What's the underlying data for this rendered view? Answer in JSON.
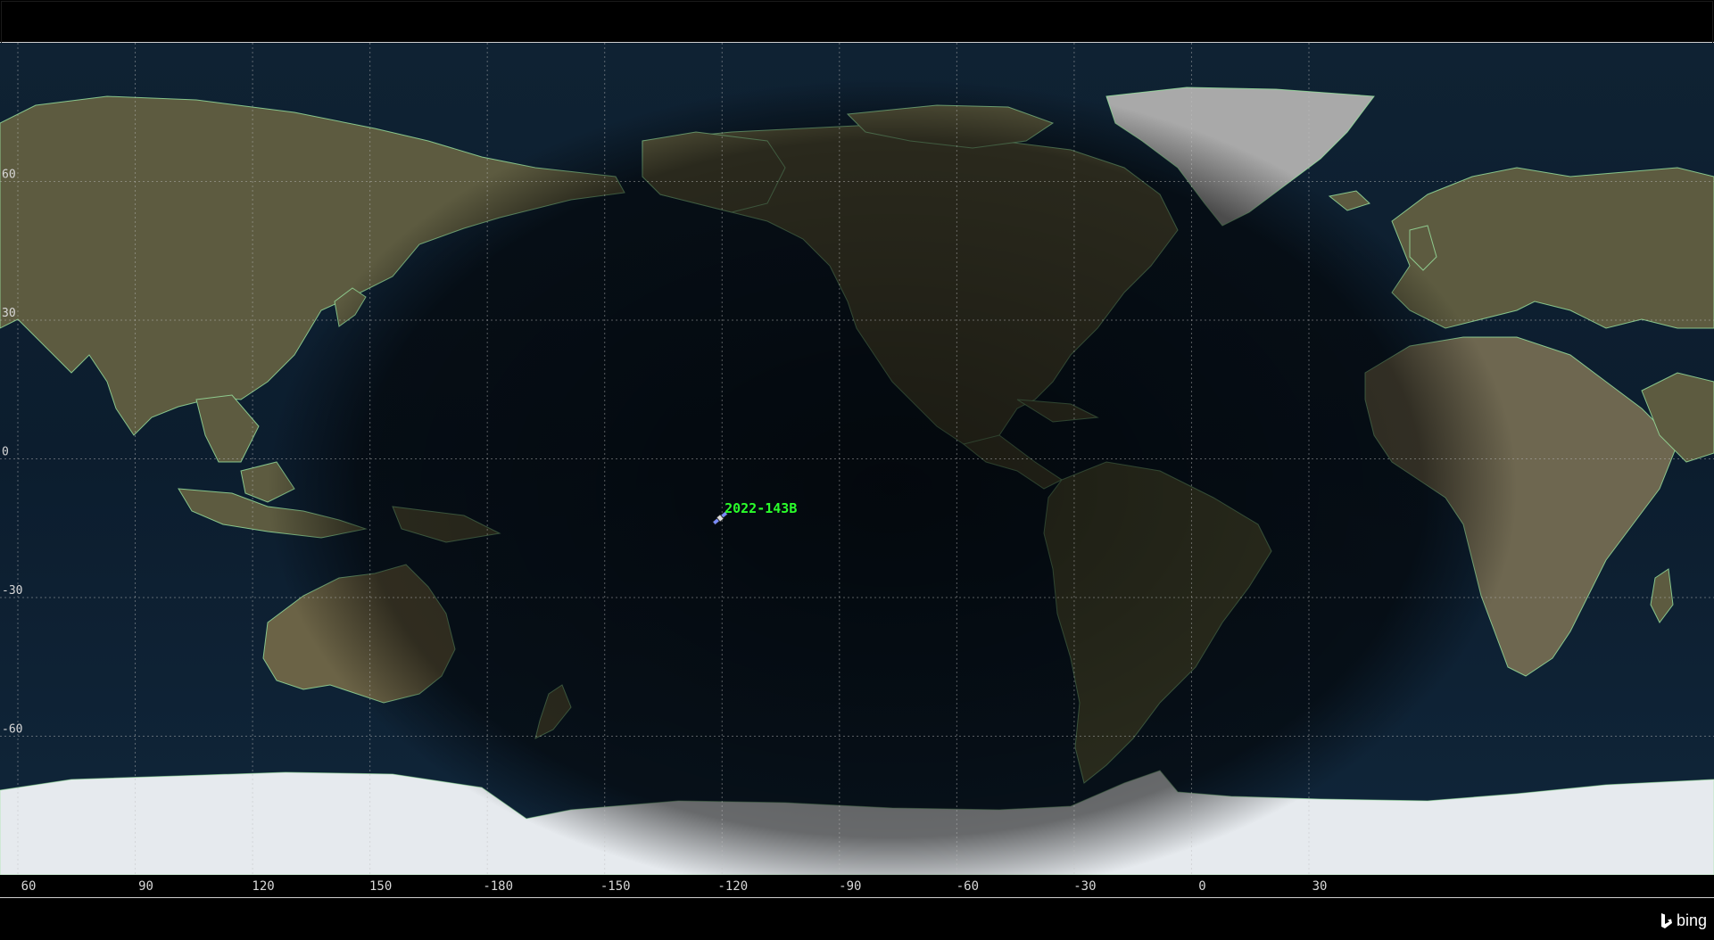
{
  "map": {
    "projection": "equirectangular",
    "center_longitude": -120,
    "lon_range": [
      -300,
      60
    ],
    "lat_range": [
      -90,
      90
    ],
    "grid": true,
    "x_ticks": [
      "60",
      "90",
      "120",
      "150",
      "-180",
      "-150",
      "-120",
      "-90",
      "-60",
      "-30",
      "0",
      "30"
    ],
    "x_tick_lons": [
      60,
      90,
      120,
      150,
      180,
      210,
      240,
      270,
      300,
      330,
      360,
      390
    ],
    "y_ticks": [
      "60",
      "30",
      "0",
      "-30",
      "-60"
    ],
    "y_tick_lats": [
      60,
      30,
      0,
      -30,
      -60
    ]
  },
  "satellite": {
    "name": "2022-143B",
    "lon": -120.5,
    "lat": -10.5,
    "label_color": "#2bff2b"
  },
  "colors": {
    "ocean": "#0b1a2a",
    "land": "#5a5a3e",
    "ice": "#e8ecef",
    "border": "#9be6a0",
    "grid": "#bfbfbf"
  },
  "attribution": {
    "logo_text": "bing",
    "icon": "bing-b-icon"
  }
}
